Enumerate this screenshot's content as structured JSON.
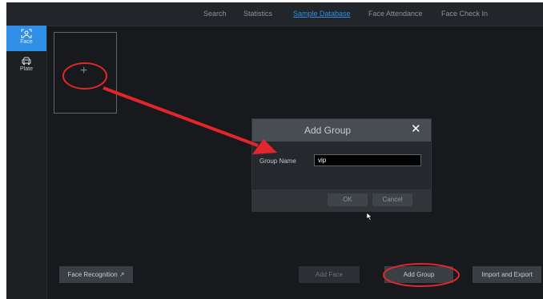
{
  "nav": {
    "tabs": [
      {
        "label": "Search"
      },
      {
        "label": "Statistics"
      },
      {
        "label": "Sample Database"
      },
      {
        "label": "Face Attendance"
      },
      {
        "label": "Face Check In"
      }
    ],
    "active_tab": "Sample Database"
  },
  "sidebar": {
    "items": [
      {
        "label": "Face",
        "icon": "face-icon"
      },
      {
        "label": "Plate",
        "icon": "car-icon"
      }
    ],
    "active_item": "Face"
  },
  "group_card": {
    "symbol": "+",
    "icon": "plus-icon"
  },
  "dialog": {
    "title": "Add Group",
    "close_icon": "close-icon",
    "field_label": "Group Name",
    "field_value": "vip",
    "ok_label": "OK",
    "cancel_label": "Cancel"
  },
  "bottom": {
    "face_recognition_label": "Face Recognition",
    "face_recognition_icon": "external-link-icon",
    "add_face_label": "Add Face",
    "add_group_label": "Add Group",
    "import_export_label": "Import and Export"
  },
  "colors": {
    "accent": "#2f8fe6",
    "annotation": "#e3262c",
    "background": "#17191c"
  }
}
